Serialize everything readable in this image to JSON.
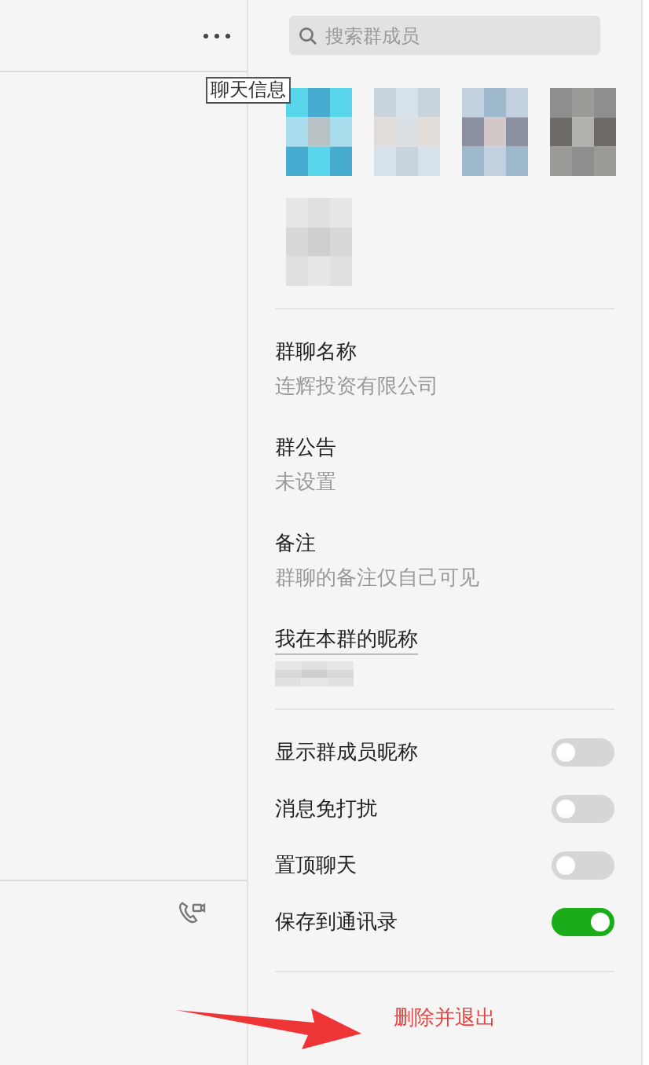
{
  "tooltip": "聊天信息",
  "search": {
    "placeholder": "搜索群成员"
  },
  "info": [
    {
      "label": "群聊名称",
      "value": "连辉投资有限公司"
    },
    {
      "label": "群公告",
      "value": "未设置"
    },
    {
      "label": "备注",
      "value": "群聊的备注仅自己可见"
    }
  ],
  "nickname": {
    "label": "我在本群的昵称"
  },
  "settings": [
    {
      "label": "显示群成员昵称",
      "on": false
    },
    {
      "label": "消息免打扰",
      "on": false
    },
    {
      "label": "置顶聊天",
      "on": false
    },
    {
      "label": "保存到通讯录",
      "on": true
    }
  ],
  "exit_button": "删除并退出"
}
